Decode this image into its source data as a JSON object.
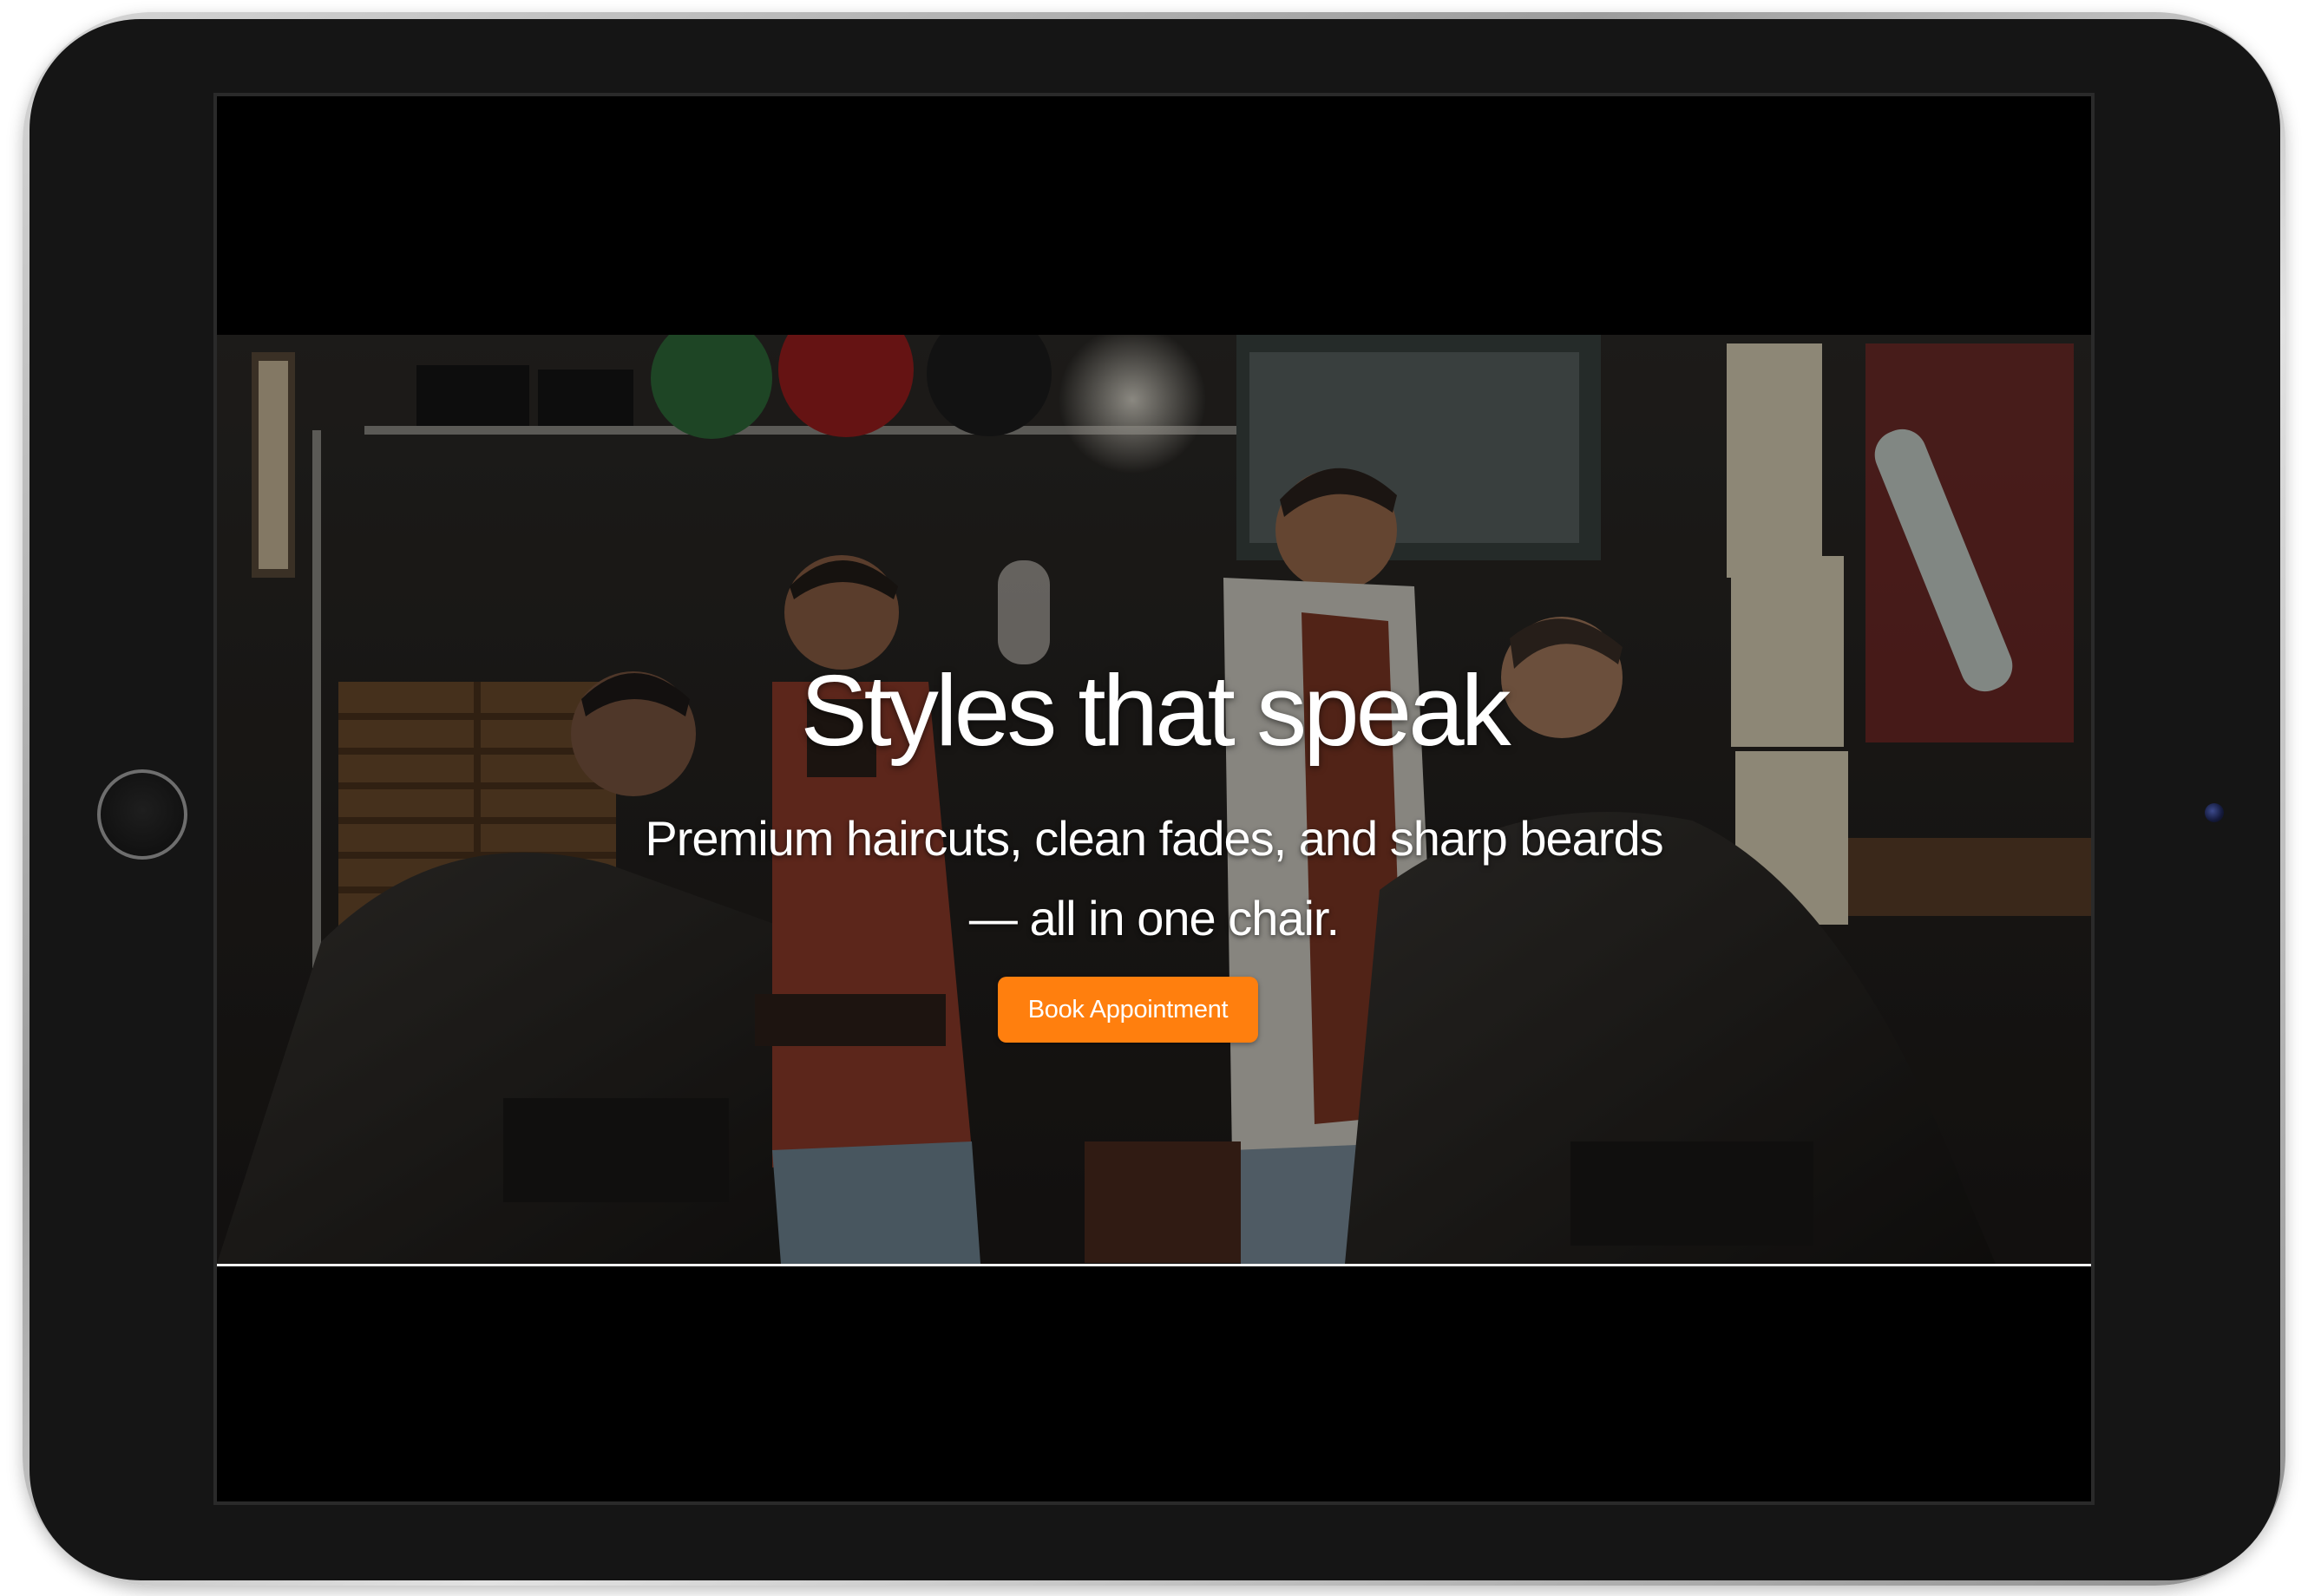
{
  "hero": {
    "title": "Styles that speak",
    "subtitle": "Premium haircuts, clean fades, and sharp beards — all in one chair.",
    "cta_label": "Book Appointment"
  },
  "colors": {
    "accent": "#ff7f0e",
    "screen_background": "#000000",
    "text": "#ffffff"
  }
}
